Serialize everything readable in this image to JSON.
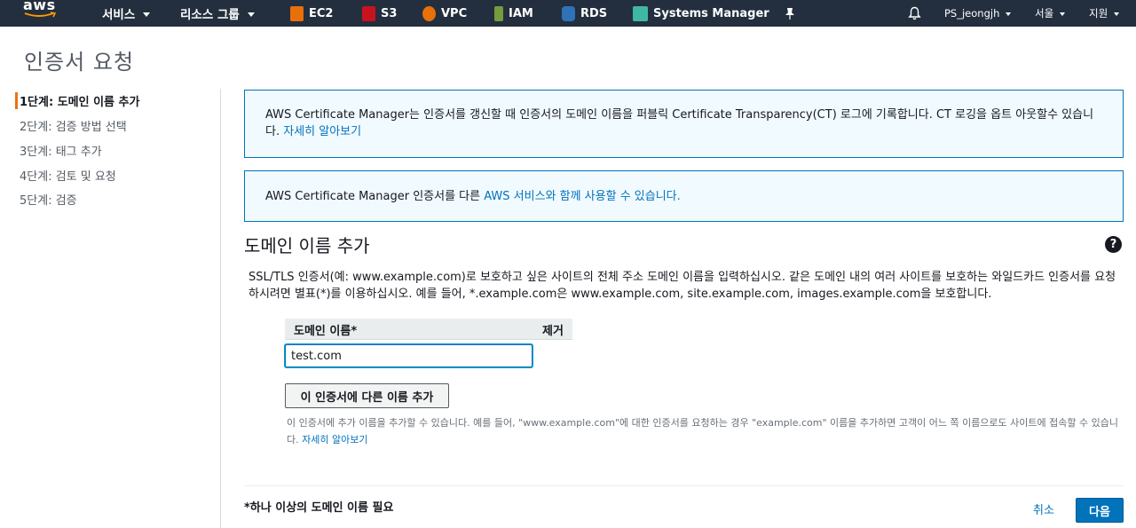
{
  "nav": {
    "logo": "aws",
    "services": "서비스",
    "resource_groups": "리소스 그룹",
    "shortcuts": [
      {
        "label": "EC2",
        "icon": "ec2-icon",
        "color": "#e8700a"
      },
      {
        "label": "S3",
        "icon": "s3-icon",
        "color": "#c7131f"
      },
      {
        "label": "VPC",
        "icon": "vpc-icon",
        "color": "#e8700a"
      },
      {
        "label": "IAM",
        "icon": "iam-icon",
        "color": "#759c3e"
      },
      {
        "label": "RDS",
        "icon": "rds-icon",
        "color": "#2e73b8"
      },
      {
        "label": "Systems Manager",
        "icon": "systems-manager-icon",
        "color": "#3fb8a3"
      }
    ],
    "user": "PS_jeongjh",
    "region": "서울",
    "support": "지원"
  },
  "page": {
    "title": "인증서 요청"
  },
  "steps": [
    {
      "label": "1단계: 도메인 이름 추가",
      "active": true
    },
    {
      "label": "2단계: 검증 방법 선택",
      "active": false
    },
    {
      "label": "3단계: 태그 추가",
      "active": false
    },
    {
      "label": "4단계: 검토 및 요청",
      "active": false
    },
    {
      "label": "5단계: 검증",
      "active": false
    }
  ],
  "info1": {
    "text": "AWS Certificate Manager는 인증서를 갱신할 때 인증서의 도메인 이름을 퍼블릭 Certificate Transparency(CT) 로그에 기록합니다. CT 로깅을 옵트 아웃할수 있습니다.",
    "link": "자세히 알아보기"
  },
  "info2": {
    "text": "AWS Certificate Manager 인증서를 다른 ",
    "link": "AWS 서비스와 함께 사용할 수 있습니다."
  },
  "section": {
    "title": "도메인 이름 추가",
    "help": "?",
    "description": "SSL/TLS 인증서(예: www.example.com)로 보호하고 싶은 사이트의 전체 주소 도메인 이름을 입력하십시오. 같은 도메인 내의 여러 사이트를 보호하는 와일드카드 인증서를 요청하시려면 별표(*)를 이용하십시오. 예를 들어, *.example.com은 www.example.com, site.example.com, images.example.com을 보호합니다."
  },
  "table": {
    "col_domain": "도메인 이름*",
    "col_remove": "제거"
  },
  "domain_input": {
    "value": "test.com"
  },
  "add_button": "이 인증서에 다른 이름 추가",
  "note": {
    "text": "이 인증서에 추가 이름을 추가할 수 있습니다. 예를 들어, \"www.example.com\"에 대한 인증서를 요청하는 경우 \"example.com\" 이름을 추가하면 고객이 어느 쪽 이름으로도 사이트에 접속할 수 있습니다.",
    "link": "자세히 알아보기"
  },
  "footer": {
    "required": "*하나 이상의 도메인 이름 필요",
    "cancel": "취소",
    "next": "다음"
  }
}
